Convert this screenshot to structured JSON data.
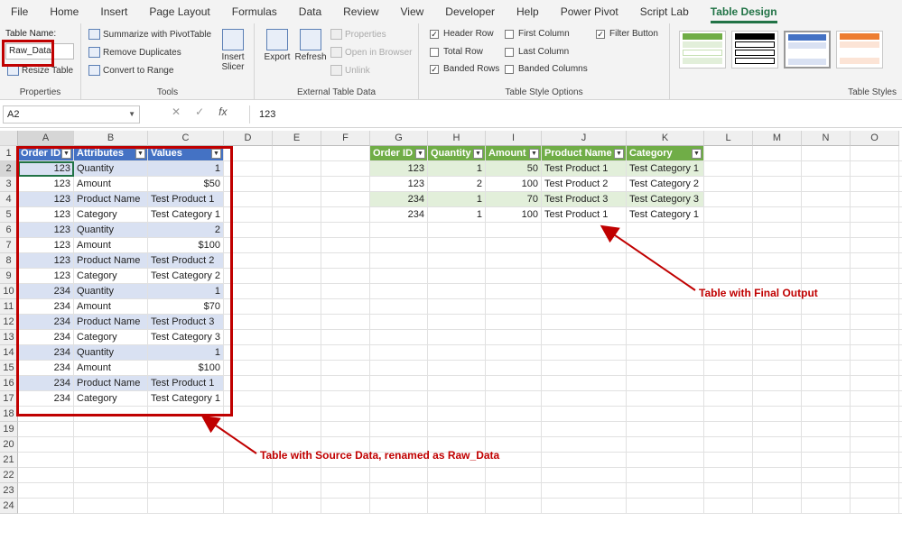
{
  "menu": [
    "File",
    "Home",
    "Insert",
    "Page Layout",
    "Formulas",
    "Data",
    "Review",
    "View",
    "Developer",
    "Help",
    "Power Pivot",
    "Script Lab",
    "Table Design"
  ],
  "active_menu": "Table Design",
  "ribbon": {
    "properties": {
      "label": "Table Name:",
      "value": "Raw_Data",
      "resize": "Resize Table",
      "group": "Properties"
    },
    "tools": {
      "summarize": "Summarize with PivotTable",
      "remove_dup": "Remove Duplicates",
      "convert": "Convert to Range",
      "insert_slicer": "Insert Slicer",
      "group": "Tools"
    },
    "external": {
      "export": "Export",
      "refresh": "Refresh",
      "properties": "Properties",
      "open_browser": "Open in Browser",
      "unlink": "Unlink",
      "group": "External Table Data"
    },
    "style_options": {
      "header_row": "Header Row",
      "total_row": "Total Row",
      "banded_rows": "Banded Rows",
      "first_column": "First Column",
      "last_column": "Last Column",
      "banded_columns": "Banded Columns",
      "filter_button": "Filter Button",
      "group": "Table Style Options"
    },
    "table_styles_group": "Table Styles"
  },
  "formula": {
    "namebox": "A2",
    "content": "123",
    "fx": "fx"
  },
  "columns": [
    "A",
    "B",
    "C",
    "D",
    "E",
    "F",
    "G",
    "H",
    "I",
    "J",
    "K",
    "L",
    "M",
    "N",
    "O"
  ],
  "rows": [
    "1",
    "2",
    "3",
    "4",
    "5",
    "6",
    "7",
    "8",
    "9",
    "10",
    "11",
    "12",
    "13",
    "14",
    "15",
    "16",
    "17",
    "18",
    "19",
    "20",
    "21",
    "22",
    "23",
    "24"
  ],
  "source_table": {
    "headers": [
      "Order ID",
      "Attributes",
      "Values"
    ],
    "rows": [
      [
        "123",
        "Quantity",
        "1"
      ],
      [
        "123",
        "Amount",
        "$50"
      ],
      [
        "123",
        "Product Name",
        "Test Product 1"
      ],
      [
        "123",
        "Category",
        "Test Category 1"
      ],
      [
        "123",
        "Quantity",
        "2"
      ],
      [
        "123",
        "Amount",
        "$100"
      ],
      [
        "123",
        "Product Name",
        "Test Product 2"
      ],
      [
        "123",
        "Category",
        "Test Category 2"
      ],
      [
        "234",
        "Quantity",
        "1"
      ],
      [
        "234",
        "Amount",
        "$70"
      ],
      [
        "234",
        "Product Name",
        "Test Product 3"
      ],
      [
        "234",
        "Category",
        "Test Category 3"
      ],
      [
        "234",
        "Quantity",
        "1"
      ],
      [
        "234",
        "Amount",
        "$100"
      ],
      [
        "234",
        "Product Name",
        "Test Product 1"
      ],
      [
        "234",
        "Category",
        "Test Category 1"
      ]
    ]
  },
  "output_table": {
    "headers": [
      "Order ID",
      "Quantity",
      "Amount",
      "Product Name",
      "Category"
    ],
    "rows": [
      [
        "123",
        "1",
        "50",
        "Test Product 1",
        "Test Category 1"
      ],
      [
        "123",
        "2",
        "100",
        "Test Product 2",
        "Test Category 2"
      ],
      [
        "234",
        "1",
        "70",
        "Test Product 3",
        "Test Category 3"
      ],
      [
        "234",
        "1",
        "100",
        "Test Product 1",
        "Test Category 1"
      ]
    ]
  },
  "annotations": {
    "output": "Table with Final Output",
    "source": "Table with Source Data, renamed as Raw_Data"
  },
  "colors": {
    "blue_header": "#4472c4",
    "blue_band": "#d9e1f2",
    "green_header": "#70ad47",
    "green_band": "#e2efda",
    "callout": "#c00000",
    "excel_green": "#217346"
  }
}
